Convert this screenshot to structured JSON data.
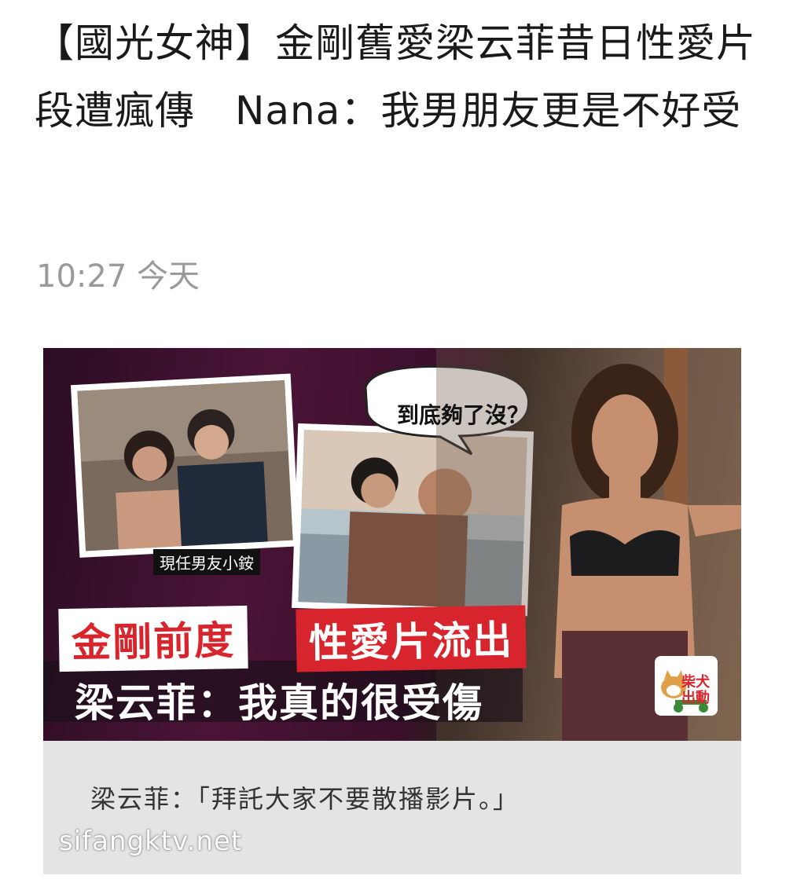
{
  "article": {
    "headline": "【國光女神】金剛舊愛梁云菲昔日性愛片段遭瘋傳　Nana：我男朋友更是不好受",
    "timestamp": "10:27 今天"
  },
  "figure": {
    "speech_bubble": "到底夠了沒？",
    "photo_tag": "現任男友小銨",
    "banner_white": "金剛前度",
    "banner_red": "性愛片流出",
    "banner_subtitle": "梁云菲：我真的很受傷",
    "logo_text": "柴犬出動",
    "caption": "梁云菲：「拜託大家不要散播影片。」",
    "watermark": "sifangktv.net"
  },
  "colors": {
    "accent_red": "#d8242c",
    "timestamp_gray": "#9a9a9a",
    "caption_bg": "#e4e4e4"
  }
}
